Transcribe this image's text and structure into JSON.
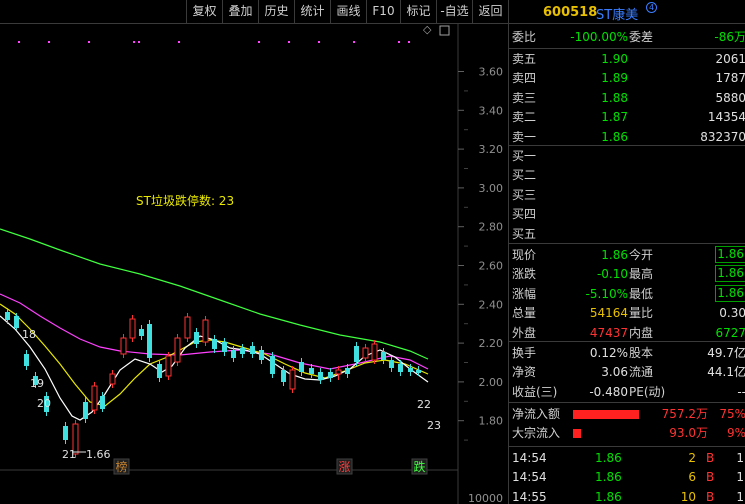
{
  "toolbar": {
    "buttons": [
      "复权",
      "叠加",
      "历史",
      "统计",
      "画线",
      "F10",
      "标记",
      "-自选",
      "返回"
    ]
  },
  "chart": {
    "price_labels": [
      "3.60",
      "3.40",
      "3.20",
      "3.00",
      "2.80",
      "2.60",
      "2.40",
      "2.20",
      "2.00",
      "1.80"
    ],
    "volume_label": "10000",
    "annotation_text": "ST垃圾跌停数: 23",
    "low_label": "1.66",
    "counters": [
      "18",
      "19",
      "20",
      "21",
      "22",
      "23"
    ],
    "badges": [
      {
        "text": "榜",
        "color": "#c08030"
      },
      {
        "text": "涨",
        "color": "#ff4040"
      },
      {
        "text": "跌",
        "color": "#40ff40"
      }
    ],
    "colors": {
      "up": "#ff3232",
      "down": "#40e0e0",
      "ma5": "#ffffff",
      "ma10": "#e8e800",
      "ma20": "#ff40ff",
      "ma60": "#40ff40"
    }
  },
  "quote": {
    "code": "600518",
    "name": "ST康美",
    "name_icon": "circle-4-icon",
    "weibi_label": "委比",
    "weibi_value": "-100.00%",
    "weicha_label": "委差",
    "weicha_value": "-86万",
    "sells": [
      {
        "label": "卖五",
        "price": "1.90",
        "vol": "2061"
      },
      {
        "label": "卖四",
        "price": "1.89",
        "vol": "1787"
      },
      {
        "label": "卖三",
        "price": "1.88",
        "vol": "5880"
      },
      {
        "label": "卖二",
        "price": "1.87",
        "vol": "14354"
      },
      {
        "label": "卖一",
        "price": "1.86",
        "vol": "832370"
      }
    ],
    "buys": [
      "买一",
      "买二",
      "买三",
      "买四",
      "买五"
    ],
    "stats": [
      {
        "l1": "现价",
        "v1": "1.86",
        "c1": "green",
        "l2": "今开",
        "v2": "1.86",
        "c2": "green",
        "box": true
      },
      {
        "l1": "涨跌",
        "v1": "-0.10",
        "c1": "green",
        "l2": "最高",
        "v2": "1.86",
        "c2": "green",
        "box": true
      },
      {
        "l1": "涨幅",
        "v1": "-5.10%",
        "c1": "green",
        "l2": "最低",
        "v2": "1.86",
        "c2": "green",
        "box": true
      },
      {
        "l1": "总量",
        "v1": "54164",
        "c1": "yellow",
        "l2": "量比",
        "v2": "0.30",
        "c2": "white",
        "box": false
      },
      {
        "l1": "外盘",
        "v1": "47437",
        "c1": "red",
        "l2": "内盘",
        "v2": "6727",
        "c2": "green",
        "box": false
      }
    ],
    "stats2": [
      {
        "l1": "换手",
        "v1": "0.12%",
        "l2": "股本",
        "v2": "49.7亿"
      },
      {
        "l1": "净资",
        "v1": "3.06",
        "l2": "流通",
        "v2": "44.1亿"
      },
      {
        "l1": "收益(三)",
        "v1": "-0.480",
        "l2": "PE(动)",
        "v2": "--"
      }
    ],
    "flows": [
      {
        "label": "净流入额",
        "value": "757.2万",
        "pct": "75%",
        "bar": 0.75
      },
      {
        "label": "大宗流入",
        "value": "93.0万",
        "pct": "9%",
        "bar": 0.09
      }
    ],
    "ticks": [
      {
        "time": "14:54",
        "price": "1.86",
        "vol": "2",
        "dir": "B",
        "n": "1"
      },
      {
        "time": "14:54",
        "price": "1.86",
        "vol": "6",
        "dir": "B",
        "n": "1"
      },
      {
        "time": "14:55",
        "price": "1.86",
        "vol": "10",
        "dir": "B",
        "n": "1"
      }
    ]
  }
}
